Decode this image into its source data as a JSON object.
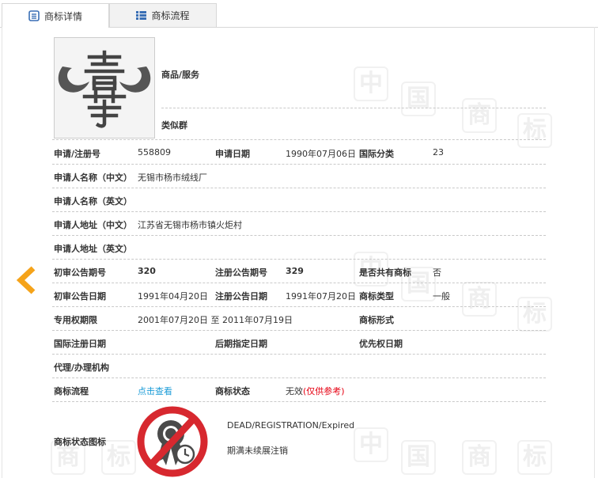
{
  "tabs": [
    {
      "label": "商标详情",
      "active": true
    },
    {
      "label": "商标流程",
      "active": false
    }
  ],
  "watermark_chars": [
    "中",
    "国",
    "商",
    "标"
  ],
  "header": {
    "goods_label": "商品/服务",
    "similar_label": "类似群"
  },
  "rows": {
    "reg_no_label": "申请/注册号",
    "reg_no": "558809",
    "apply_date_label": "申请日期",
    "apply_date": "1990年07月06日",
    "intl_class_label": "国际分类",
    "intl_class": "23",
    "applicant_cn_label": "申请人名称（中文）",
    "applicant_cn": "无锡市杨市绒线厂",
    "applicant_en_label": "申请人名称（英文）",
    "applicant_en": "",
    "address_cn_label": "申请人地址（中文）",
    "address_cn": "江苏省无锡市杨市镇火炬村",
    "address_en_label": "申请人地址（英文）",
    "address_en": "",
    "prelim_pub_no_label": "初审公告期号",
    "prelim_pub_no": "320",
    "reg_pub_no_label": "注册公告期号",
    "reg_pub_no": "329",
    "shared_label": "是否共有商标",
    "shared": "否",
    "prelim_pub_date_label": "初审公告日期",
    "prelim_pub_date": "1991年04月20日",
    "reg_pub_date_label": "注册公告日期",
    "reg_pub_date": "1991年07月20日",
    "tm_type_label": "商标类型",
    "tm_type": "一般",
    "exclusive_period_label": "专用权期限",
    "exclusive_period": "2001年07月20日 至 2011年07月19日",
    "tm_form_label": "商标形式",
    "tm_form": "",
    "intl_reg_date_label": "国际注册日期",
    "intl_reg_date": "",
    "later_date_label": "后期指定日期",
    "later_date": "",
    "priority_date_label": "优先权日期",
    "priority_date": "",
    "agency_label": "代理/办理机构",
    "agency": "",
    "process_label": "商标流程",
    "process_link": "点击查看",
    "status_label": "商标状态",
    "status_value": "无效",
    "status_note": "(仅供参考)",
    "status_icon_label": "商标状态图标",
    "status_en": "DEAD/REGISTRATION/Expired",
    "status_cn": "期满未续展注销"
  },
  "colors": {
    "accent": "#1a9bd7",
    "arrow": "#f5a31a",
    "invalid": "#e60012",
    "icon_red": "#d7282f",
    "icon_dark": "#4a4a4a"
  }
}
